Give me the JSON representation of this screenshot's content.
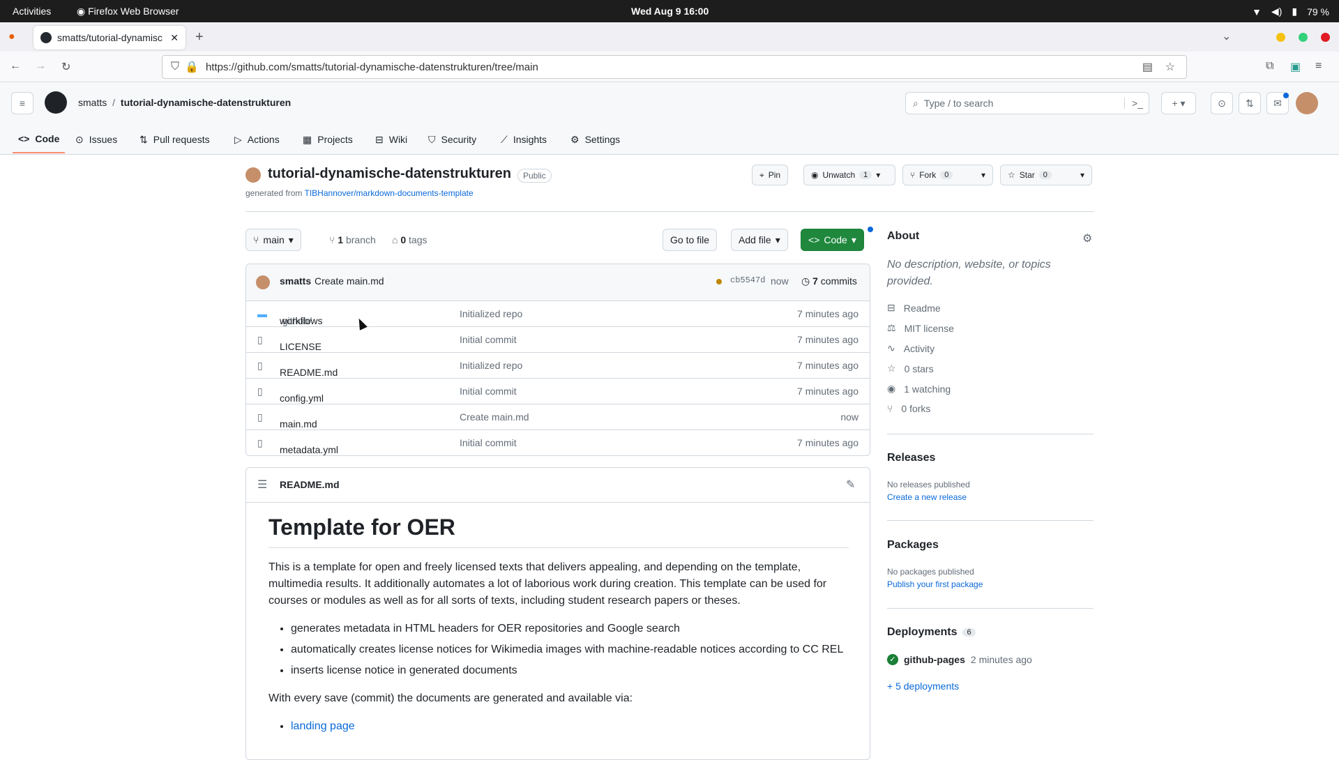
{
  "os_bar": {
    "activities": "Activities",
    "app": "Firefox Web Browser",
    "clock": "Wed Aug 9  16:00",
    "battery": "79 %"
  },
  "browser": {
    "tab_title": "smatts/tutorial-dynamisc",
    "url": "https://github.com/smatts/tutorial-dynamische-datenstrukturen/tree/main"
  },
  "gh": {
    "owner": "smatts",
    "repo": "tutorial-dynamische-datenstrukturen",
    "search_placeholder": "Type / to search",
    "tabs": [
      "Code",
      "Issues",
      "Pull requests",
      "Actions",
      "Projects",
      "Wiki",
      "Security",
      "Insights",
      "Settings"
    ]
  },
  "repo": {
    "name": "tutorial-dynamische-datenstrukturen",
    "visibility": "Public",
    "generated_prefix": "generated from",
    "generated_link": "TIBHannover/markdown-documents-template",
    "pin": "Pin",
    "unwatch": "Unwatch",
    "watch_count": "1",
    "fork": "Fork",
    "fork_count": "0",
    "star": "Star",
    "star_count": "0",
    "branch": "main",
    "branches_count": "1",
    "branches_label": "branch",
    "tags_count": "0",
    "tags_label": "tags",
    "go_to_file": "Go to file",
    "add_file": "Add file",
    "code": "Code"
  },
  "commit": {
    "author": "smatts",
    "message": "Create main.md",
    "sha": "cb5547d",
    "time": "now",
    "count": "7",
    "count_label": "commits"
  },
  "files": [
    {
      "dim": ".github/",
      "name": "workflows",
      "msg": "Initialized repo",
      "time": "7 minutes ago",
      "icon": "folder"
    },
    {
      "dim": "",
      "name": "LICENSE",
      "msg": "Initial commit",
      "time": "7 minutes ago",
      "icon": "file"
    },
    {
      "dim": "",
      "name": "README.md",
      "msg": "Initialized repo",
      "time": "7 minutes ago",
      "icon": "file"
    },
    {
      "dim": "",
      "name": "config.yml",
      "msg": "Initial commit",
      "time": "7 minutes ago",
      "icon": "file"
    },
    {
      "dim": "",
      "name": "main.md",
      "msg": "Create main.md",
      "time": "now",
      "icon": "file"
    },
    {
      "dim": "",
      "name": "metadata.yml",
      "msg": "Initial commit",
      "time": "7 minutes ago",
      "icon": "file"
    }
  ],
  "readme": {
    "file": "README.md",
    "h1": "Template for OER",
    "p1": "This is a template for open and freely licensed texts that delivers appealing, and depending on the template, multimedia results. It additionally automates a lot of laborious work during creation. This template can be used for courses or modules as well as for all sorts of texts, including student research papers or theses.",
    "bullets": [
      "generates metadata in HTML headers for OER repositories and Google search",
      "automatically creates license notices for Wikimedia images with machine-readable notices according to CC REL",
      "inserts license notice in generated documents"
    ],
    "p2": "With every save (commit) the documents are generated and available via:",
    "link": "landing page"
  },
  "about": {
    "title": "About",
    "desc": "No description, website, or topics provided.",
    "items": [
      "Readme",
      "MIT license",
      "Activity",
      "0 stars",
      "1 watching",
      "0 forks"
    ]
  },
  "releases": {
    "title": "Releases",
    "none": "No releases published",
    "link": "Create a new release"
  },
  "packages": {
    "title": "Packages",
    "none": "No packages published",
    "link": "Publish your first package"
  },
  "deployments": {
    "title": "Deployments",
    "count": "6",
    "env": "github-pages",
    "when": "2 minutes ago",
    "more": "+ 5 deployments"
  }
}
